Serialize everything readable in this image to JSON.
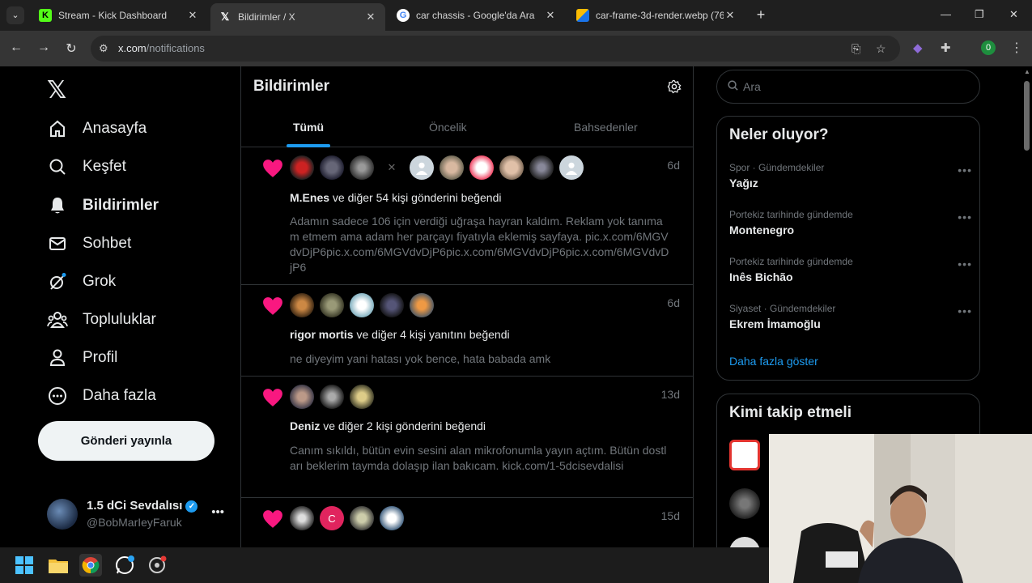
{
  "browser": {
    "tabs": [
      {
        "title": "Stream - Kick Dashboard",
        "favicon": "K"
      },
      {
        "title": "Bildirimler / X",
        "favicon": "𝕏"
      },
      {
        "title": "car chassis - Google'da Ara",
        "favicon": "G"
      },
      {
        "title": "car-frame-3d-render.webp (76",
        "favicon": "▮"
      }
    ],
    "url_domain": "x.com",
    "url_path": "/notifications",
    "profile_initial": "0"
  },
  "nav": {
    "items": [
      {
        "label": "Anasayfa",
        "icon": "home-icon"
      },
      {
        "label": "Keşfet",
        "icon": "search-icon"
      },
      {
        "label": "Bildirimler",
        "icon": "bell-icon"
      },
      {
        "label": "Sohbet",
        "icon": "mail-icon"
      },
      {
        "label": "Grok",
        "icon": "grok-icon"
      },
      {
        "label": "Topluluklar",
        "icon": "people-icon"
      },
      {
        "label": "Profil",
        "icon": "person-icon"
      },
      {
        "label": "Daha fazla",
        "icon": "more-circle-icon"
      }
    ],
    "post_button": "Gönderi yayınla",
    "account": {
      "name": "1.5 dCi Sevdalısı",
      "handle": "@BobMarIeyFaruk"
    }
  },
  "main": {
    "title": "Bildirimler",
    "tabs": [
      "Tümü",
      "Öncelik",
      "Bahsedenler"
    ],
    "notifications": [
      {
        "time": "6d",
        "actor": "M.Enes",
        "action": " ve diğer 54 kişi gönderini beğendi",
        "text": "Adamın sadece 106 için verdiği uğraşa hayran kaldım. Reklam yok tanımam etmem ama adam her parçayı fiyatıyla eklemiş sayfaya. pic.x.com/6MGVdvDjP6pic.x.com/6MGVdvDjP6pic.x.com/6MGVdvDjP6pic.x.com/6MGVdvDjP6"
      },
      {
        "time": "6d",
        "actor": "rigor mortis",
        "action": " ve diğer 4 kişi yanıtını beğendi",
        "text": "ne diyeyim yani hatası yok bence, hata babada amk"
      },
      {
        "time": "13d",
        "actor": "Deniz",
        "action": " ve diğer 2 kişi gönderini beğendi",
        "text": "Canım sıkıldı, bütün evin sesini alan mikrofonumla yayın açtım. Bütün dostları beklerim taymda dolaşıp ilan bakıcam. kick.com/1-5dcisevdalisi"
      },
      {
        "time": "15d",
        "avatar_letter": "C"
      }
    ]
  },
  "sidebar": {
    "search_placeholder": "Ara",
    "trends_title": "Neler oluyor?",
    "trends": [
      {
        "context": "Spor · Gündemdekiler",
        "topic": "Yağız"
      },
      {
        "context": "Portekiz tarihinde gündemde",
        "topic": "Montenegro"
      },
      {
        "context": "Portekiz tarihinde gündemde",
        "topic": "Inês Bichão"
      },
      {
        "context": "Siyaset · Gündemdekiler",
        "topic": "Ekrem İmamoğlu"
      }
    ],
    "show_more": "Daha fazla göster",
    "follow_title": "Kimi takip etmeli"
  },
  "colors": {
    "accent": "#1d9bf0",
    "like": "#f91880",
    "background": "#000000",
    "border": "#2f3336",
    "muted": "#71767b"
  }
}
